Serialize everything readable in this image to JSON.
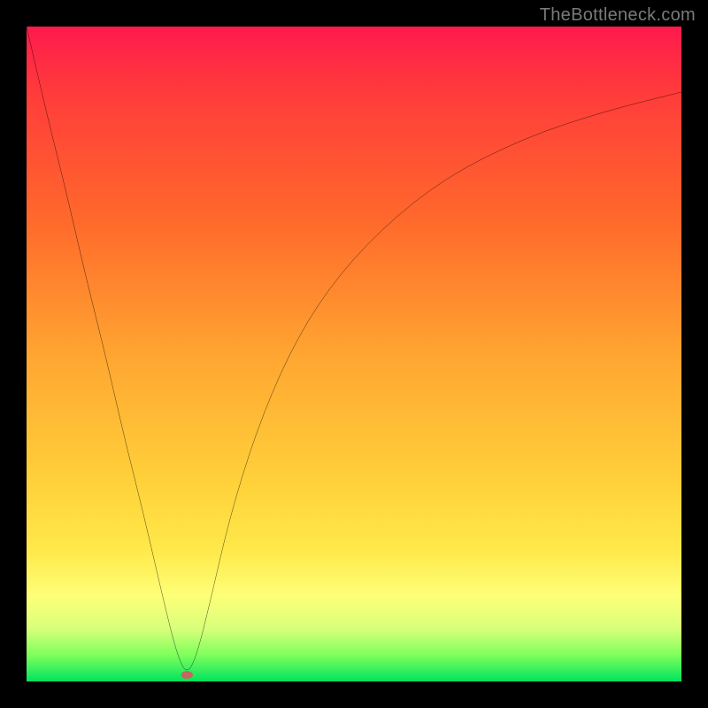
{
  "watermark": "TheBottleneck.com",
  "colors": {
    "frame_border": "#000000",
    "curve_stroke": "#000000",
    "marker_fill": "#c06a5e",
    "gradient_stops": [
      "#ff1a4d",
      "#ff3b3b",
      "#ff6a2b",
      "#ffa531",
      "#ffd23a",
      "#ffe94a",
      "#feff78",
      "#d8ff7a",
      "#7dff5c",
      "#00e35e"
    ]
  },
  "chart_data": {
    "type": "line",
    "title": "",
    "xlabel": "",
    "ylabel": "",
    "xlim": [
      0,
      100
    ],
    "ylim": [
      0,
      100
    ],
    "x": [
      0,
      3,
      6,
      9,
      12,
      15,
      18,
      21,
      23,
      24.5,
      26,
      28,
      31,
      35,
      40,
      46,
      54,
      64,
      76,
      88,
      100
    ],
    "values": [
      100,
      87,
      75,
      62,
      50,
      37,
      25,
      12,
      4,
      1,
      4,
      12,
      25,
      38,
      50,
      60,
      69,
      77,
      83,
      87,
      90
    ],
    "marker": {
      "x": 24.5,
      "y": 1,
      "color": "#c06a5e"
    },
    "notes": "Axes are unlabeled in the source image; x and y are normalized 0–100 with (0,0) at bottom-left. values[] are percentage distance from the bottom (plotted as 100 - y in SVG space)."
  }
}
